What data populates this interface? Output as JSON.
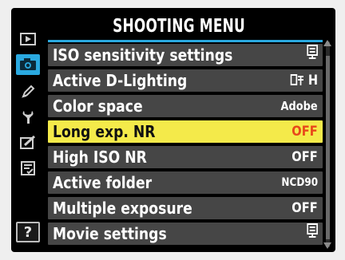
{
  "header": {
    "title": "SHOOTING MENU"
  },
  "tabs": [
    {
      "icon": "playback-icon"
    },
    {
      "icon": "camera-icon",
      "active": true
    },
    {
      "icon": "pencil-icon"
    },
    {
      "icon": "wrench-icon"
    },
    {
      "icon": "retouch-icon"
    },
    {
      "icon": "my-menu-icon"
    },
    {
      "icon": "help-icon",
      "label": "?"
    }
  ],
  "menu": {
    "items": [
      {
        "label": "ISO sensitivity settings",
        "value": "",
        "value_icon": "setting-icon"
      },
      {
        "label": "Active D-Lighting",
        "value": "H",
        "value_icon": "d-lighting-icon"
      },
      {
        "label": "Color space",
        "value": "Adobe"
      },
      {
        "label": "Long exp. NR",
        "value": "OFF",
        "selected": true
      },
      {
        "label": "High ISO NR",
        "value": "OFF"
      },
      {
        "label": "Active folder",
        "value": "NCD90"
      },
      {
        "label": "Multiple exposure",
        "value": "OFF"
      },
      {
        "label": "Movie settings",
        "value": "",
        "value_icon": "setting-icon"
      }
    ]
  },
  "colors": {
    "accent": "#2aa9e0",
    "selected_bg": "#f4ea4a",
    "selected_value": "#e8481a",
    "row_bg": "#464646"
  }
}
